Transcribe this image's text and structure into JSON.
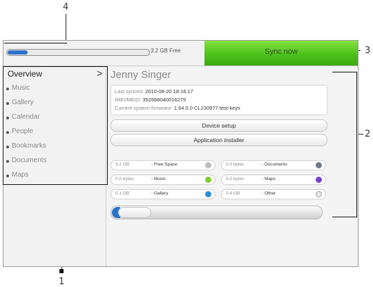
{
  "callouts": {
    "n1": "1",
    "n2": "2",
    "n3": "3",
    "n4": "4"
  },
  "storage": {
    "free_text": "3.2 GB Free",
    "used_fraction": 0.14
  },
  "sync": {
    "label": "Sync now"
  },
  "sidebar": {
    "overview": "Overview",
    "chevron": ">",
    "items": [
      "Music",
      "Gallery",
      "Calendar",
      "People",
      "Bookmarks",
      "Documents",
      "Maps"
    ]
  },
  "device": {
    "name": "Jenny Singer",
    "last_synced_key": "Last synced:",
    "last_synced_val": "2010-08-20 18:16:17",
    "imei_key": "IMEI/MEID:",
    "imei_val": "352668040016279",
    "firmware_key": "Current system firmware:",
    "firmware_val": "1.64.0.0 CL230977 test-keys"
  },
  "buttons": {
    "device_setup": "Device setup",
    "app_installer": "Application installer"
  },
  "storage_breakdown": [
    {
      "size": "3.2 GB",
      "label": "- Free Space",
      "color": "#bdbdbd"
    },
    {
      "size": "0.0 bytes",
      "label": "- Documents",
      "color": "#6d7a8a"
    },
    {
      "size": "0.0 bytes",
      "label": "- Music",
      "color": "#7ccf2b"
    },
    {
      "size": "0.0 bytes",
      "label": "- Maps",
      "color": "#7a3ec9"
    },
    {
      "size": "0.1 GB",
      "label": "- Gallery",
      "color": "#2b8fd8"
    },
    {
      "size": "0.4 GB",
      "label": "- Other",
      "color": "#e6e6e6"
    }
  ],
  "total_bar": {
    "used_fraction": 0.04
  }
}
